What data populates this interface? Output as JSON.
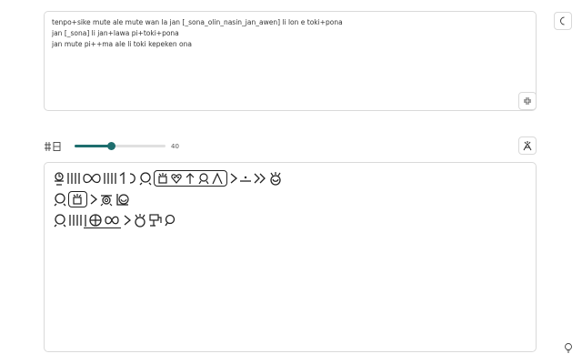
{
  "input": {
    "lines": [
      "tenpo+sike mute ale mute wan la jan [_sona_olin_nasin_jan_awen] li lon e toki+pona",
      "jan [_sona] li jan+lawa pi+toki+pona",
      "jan mute pi++ma ale li toki kepeken ona"
    ]
  },
  "font_size": {
    "value": 40,
    "min": 0,
    "max": 100
  },
  "icons": {
    "theme": "moon-icon",
    "collapse": "collapse-icon",
    "size": "font-size-icon",
    "style": "style-toggle-icon",
    "tips": "lightbulb-icon"
  },
  "colors": {
    "accent": "#1e6e6e",
    "border": "#d9d9d9",
    "text": "#222222"
  }
}
